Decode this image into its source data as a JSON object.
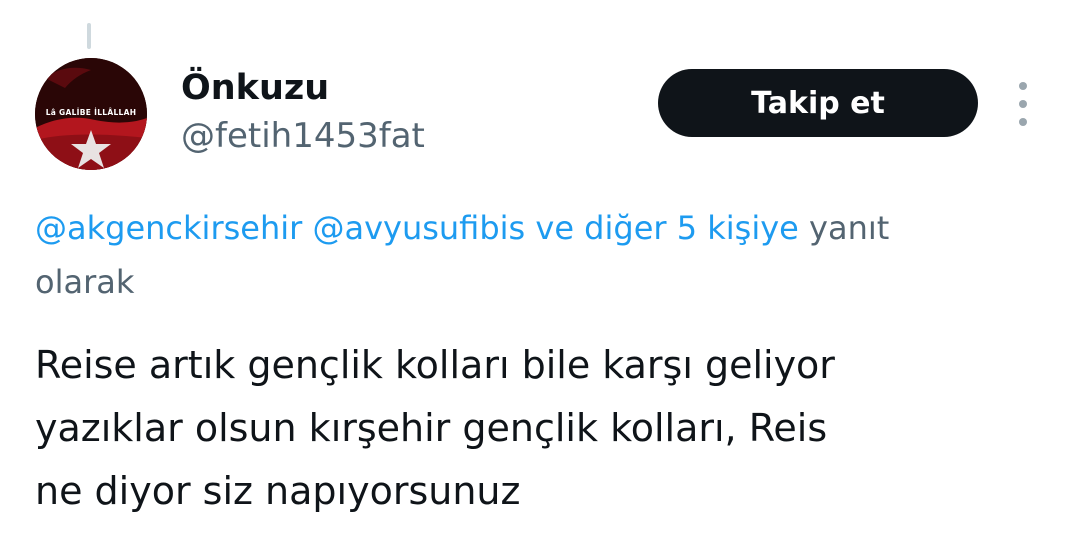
{
  "user": {
    "display_name": "Önkuzu",
    "handle": "@fetih1453fat",
    "avatar_text": "Lâ GALİBE İLLÂLLAH",
    "avatar_colors": {
      "background": "#2a0606",
      "flag_red": "#b3161e",
      "star": "#e8e2e2"
    }
  },
  "actions": {
    "follow_label": "Takip et",
    "more_icon": "more-vertical-icon"
  },
  "reply_context": {
    "mention_1": "@akgenckirsehir",
    "mention_2": "@avyusufibis",
    "others": "ve diğer 5 kişiye",
    "suffix_line1": "yanıt",
    "suffix_line2": "olarak"
  },
  "tweet": {
    "lines": [
      "Reise artık gençlik kolları bile karşı geliyor",
      "yazıklar olsun kırşehir gençlik kolları, Reis",
      "ne diyor siz napıyorsunuz"
    ]
  },
  "colors": {
    "text": "#0f1419",
    "secondary": "#536471",
    "link": "#1d9bf0",
    "button_bg": "#0f1419",
    "button_text": "#ffffff"
  }
}
